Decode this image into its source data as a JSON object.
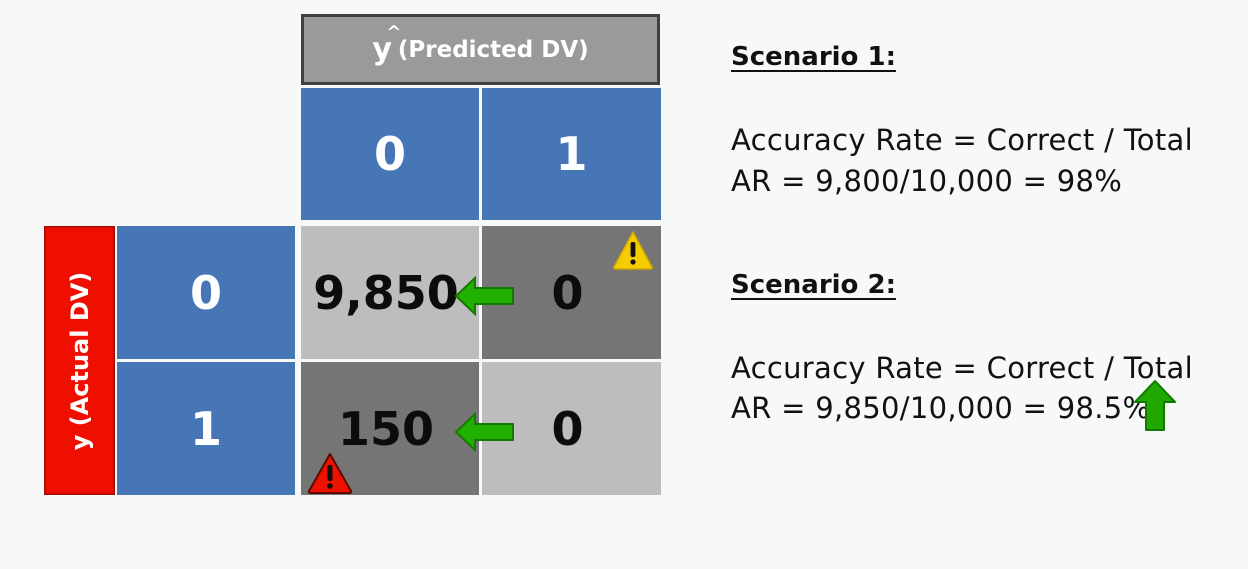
{
  "matrix": {
    "predicted_header": {
      "symbol": "y",
      "hat": "^",
      "label": "(Predicted DV)"
    },
    "actual_header": "y (Actual DV)",
    "column_labels": [
      "0",
      "1"
    ],
    "row_labels": [
      "0",
      "1"
    ],
    "cells": [
      [
        "9,850",
        "0"
      ],
      [
        "150",
        "0"
      ]
    ],
    "colors": {
      "header_blue": "#4676b6",
      "actual_red": "#ee0f00",
      "predicted_grey": "#999b9a",
      "cell_light": "#bdbdbd",
      "cell_dark": "#757575",
      "arrow_green": "#1fae00"
    }
  },
  "annotations": {
    "arrow_row0": "left-arrow",
    "arrow_row1": "left-arrow",
    "warning_top_right": "warning-yellow",
    "warning_bottom_left": "warning-red"
  },
  "scenarios": [
    {
      "title": "Scenario 1:",
      "formula": "Accuracy Rate = Correct / Total",
      "calc": "AR = 9,800/10,000 = 98%"
    },
    {
      "title": "Scenario 2:",
      "formula": "Accuracy Rate = Correct / Total",
      "calc": "AR = 9,850/10,000 = 98.5%",
      "trend_icon": "up-arrow"
    }
  ]
}
